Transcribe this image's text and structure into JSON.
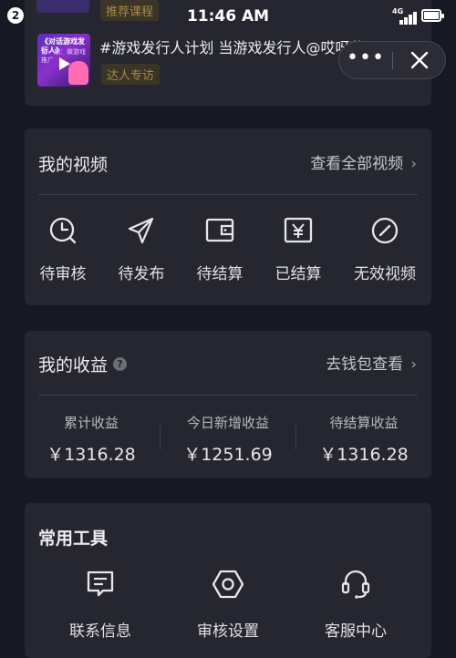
{
  "status_bar": {
    "notification_count": "2",
    "time": "11:46 AM",
    "network": "4G"
  },
  "top_card": {
    "partial_tag": "推荐课程",
    "video_title": "#游戏发行人计划 当游戏发行人@哎呀茜...",
    "tag": "达人专访",
    "thumbnail_text_1": "《对话游戏发行人》",
    "thumbnail_text_2": "第一期：做游戏推广"
  },
  "capsule": {
    "more_label": "•••"
  },
  "my_videos": {
    "title": "我的视频",
    "link": "查看全部视频",
    "items": [
      {
        "label": "待审核",
        "icon": "clock-icon"
      },
      {
        "label": "待发布",
        "icon": "send-icon"
      },
      {
        "label": "待结算",
        "icon": "wallet-icon"
      },
      {
        "label": "已结算",
        "icon": "yen-icon"
      },
      {
        "label": "无效视频",
        "icon": "invalid-icon"
      }
    ]
  },
  "my_earnings": {
    "title": "我的收益",
    "link": "去钱包查看",
    "stats": [
      {
        "label": "累计收益",
        "value": "￥1316.28"
      },
      {
        "label": "今日新增收益",
        "value": "￥1251.69"
      },
      {
        "label": "待结算收益",
        "value": "￥1316.28"
      }
    ]
  },
  "tools": {
    "title": "常用工具",
    "items": [
      {
        "label": "联系信息",
        "icon": "message-icon"
      },
      {
        "label": "审核设置",
        "icon": "settings-hex-icon"
      },
      {
        "label": "客服中心",
        "icon": "headset-icon"
      }
    ]
  },
  "colors": {
    "background": "#161823",
    "card": "#25262f",
    "tag_text": "#a78a47",
    "tag_bg": "#3a3526"
  }
}
